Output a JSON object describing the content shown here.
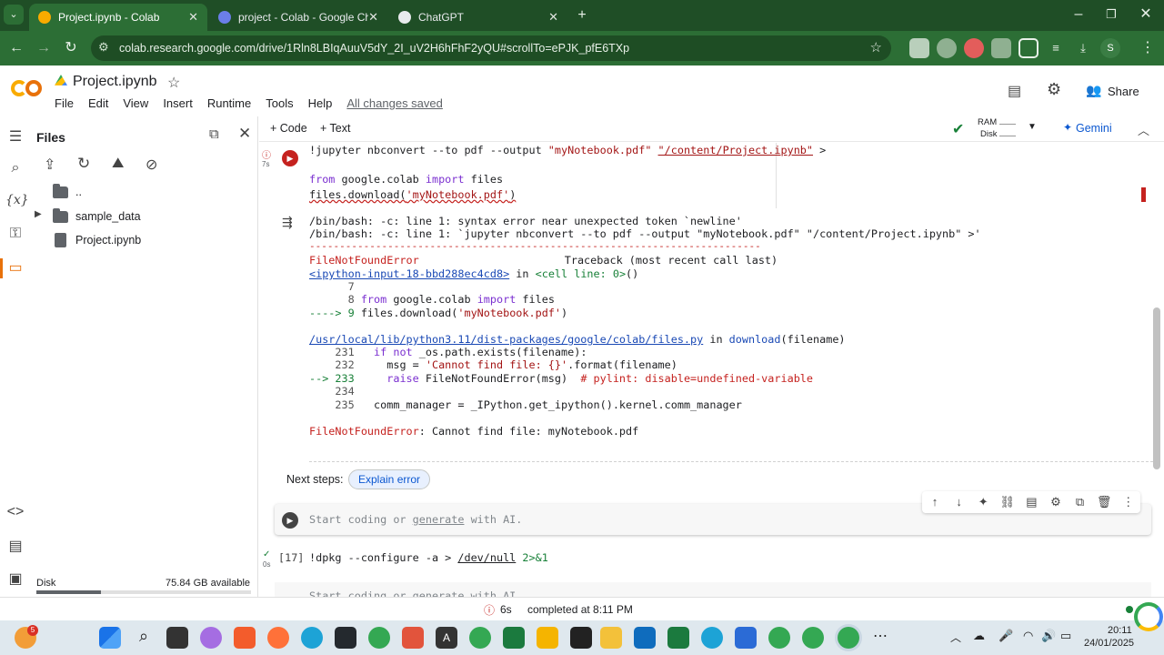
{
  "browser": {
    "tabs": [
      {
        "title": "Project.ipynb - Colab",
        "active": true
      },
      {
        "title": "project - Colab - Google Chrom",
        "active": false
      },
      {
        "title": "ChatGPT",
        "active": false
      }
    ],
    "url": "colab.research.google.com/drive/1Rln8LBIqAuuV5dY_2I_uV2H6hFhF2yQU#scrollTo=ePJK_pfE6TXp",
    "profile_initial": "S"
  },
  "header": {
    "notebook_title": "Project.ipynb",
    "menu": [
      "File",
      "Edit",
      "View",
      "Insert",
      "Runtime",
      "Tools",
      "Help"
    ],
    "save_status": "All changes saved",
    "share_label": "Share"
  },
  "files_panel": {
    "title": "Files",
    "items": [
      {
        "name": "..",
        "type": "folder"
      },
      {
        "name": "sample_data",
        "type": "folder"
      },
      {
        "name": "Project.ipynb",
        "type": "file"
      }
    ],
    "disk_label": "Disk",
    "disk_available": "75.84 GB available",
    "disk_usage_fraction": 0.3
  },
  "cell_toolbar": {
    "code_label": "+ Code",
    "text_label": "+ Text",
    "ram_label": "RAM",
    "disk_label": "Disk",
    "gemini_label": "Gemini"
  },
  "cell1": {
    "exec_time": "7s",
    "line1": "!jupyter nbconvert --to pdf --output ",
    "line1_s1": "\"myNotebook.pdf\"",
    "line1_s2": "\"/content/Project.ipynb\"",
    "line1_tail": ">",
    "line3_kw1": "from",
    "line3_mid": " google.colab ",
    "line3_kw2": "import",
    "line3_tail": " files",
    "line4_a": "files.download(",
    "line4_s": "'myNotebook.pdf'",
    "line4_b": ")"
  },
  "output": {
    "bash1": "/bin/bash: -c: line 1: syntax error near unexpected token `newline'",
    "bash2": "/bin/bash: -c: line 1: `jupyter nbconvert --to pdf --output \"myNotebook.pdf\" \"/content/Project.ipynb\" >'",
    "dashes": "---------------------------------------------------------------------------",
    "err_name": "FileNotFoundError",
    "traceback": "Traceback (most recent call last)",
    "input_link": "<ipython-input-18-bbd288ec4cd8>",
    "in_word": " in ",
    "cell_line": "<cell line: 0>",
    "paren": "()",
    "l7": "      7",
    "l8_num": "      8 ",
    "l8_kw1": "from",
    "l8_mid": " google.colab ",
    "l8_kw2": "import",
    "l8_tail": " files",
    "l9_arrow": "----> 9 ",
    "l9_a": "files.download(",
    "l9_s": "'myNotebook.pdf'",
    "l9_b": ")",
    "path": "/usr/local/lib/python3.11/dist-packages/google/colab/files.py",
    "in2": " in ",
    "func": "download",
    "func_args": "(filename)",
    "l231_num": "    231 ",
    "l231_kw": "  if not",
    "l231_tail": " _os.path.exists(filename):",
    "l232_num": "    232 ",
    "l232_a": "    msg = ",
    "l232_s": "'Cannot find file: {}'",
    "l232_b": ".format(filename)",
    "l233_arrow": "--> 233 ",
    "l233_kw": "    raise",
    "l233_a": " FileNotFoundError(msg)  ",
    "l233_c": "# pylint: disable=undefined-variable",
    "l234": "    234",
    "l235_num": "    235 ",
    "l235_a": "  comm_manager = _IPython.get_ipython().kernel.comm_manager",
    "final_name": "FileNotFoundError",
    "final_msg": ": Cannot find file: myNotebook.pdf"
  },
  "next_steps": {
    "label": "Next steps:",
    "button": "Explain error"
  },
  "empty_cell": {
    "placeholder_a": "Start coding or ",
    "placeholder_link": "generate",
    "placeholder_b": " with AI."
  },
  "cell17": {
    "exec_count": "[17]",
    "exec_time": "0s",
    "code_a": "!dpkg --configure -a > ",
    "code_path": "/dev/null",
    "code_b": " 2>&1"
  },
  "cell_partial": {
    "placeholder": "Start coding or generate with AI."
  },
  "status_bar": {
    "time": "6s",
    "text": "completed at 8:11 PM"
  },
  "taskbar": {
    "clock": "20:11",
    "date": "24/01/2025",
    "weather_badge": "5"
  },
  "colors": {
    "chrome_tab": "#1f4e26",
    "chrome_toolbar": "#2c6e35",
    "colab_orange": "#f9ab00",
    "error_red": "#c5221f"
  }
}
